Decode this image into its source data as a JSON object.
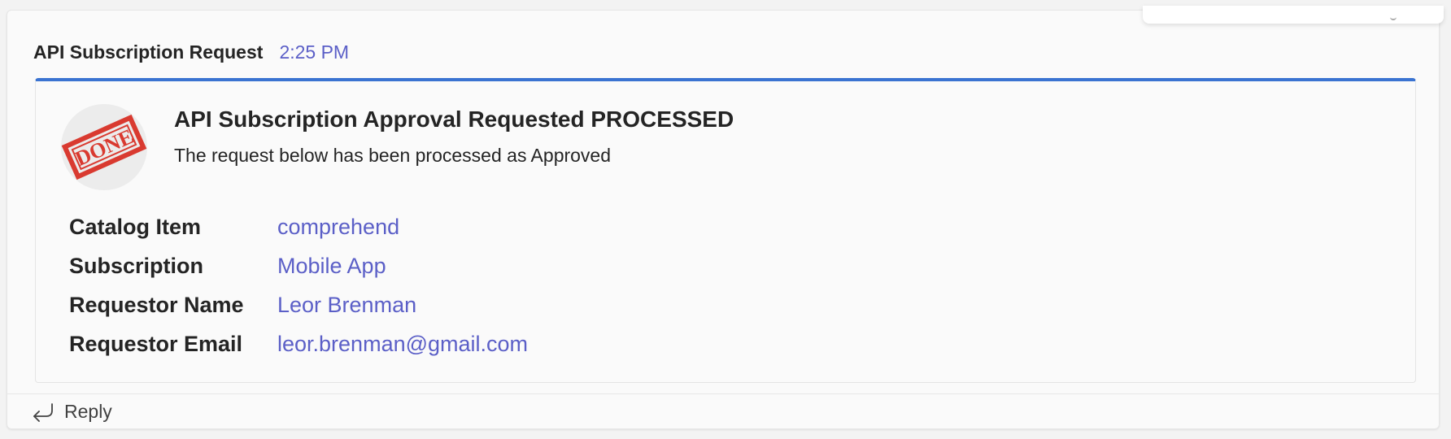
{
  "message": {
    "sender": "API Subscription Request",
    "timestamp": "2:25 PM"
  },
  "card": {
    "badge_icon": "done-stamp-icon",
    "badge_text": "DONE",
    "title": "API Subscription Approval Requested PROCESSED",
    "subtitle": "The request below has been processed as Approved",
    "facts": [
      {
        "label": "Catalog Item",
        "value": "comprehend"
      },
      {
        "label": "Subscription",
        "value": "Mobile App"
      },
      {
        "label": "Requestor Name",
        "value": "Leor Brenman"
      },
      {
        "label": "Requestor Email",
        "value": "leor.brenman@gmail.com"
      }
    ],
    "accent_color": "#3a73d1"
  },
  "footer": {
    "reply_label": "Reply",
    "reply_icon": "reply-arrow-icon"
  },
  "colors": {
    "link": "#5b5fc7",
    "stamp": "#d93a30"
  }
}
